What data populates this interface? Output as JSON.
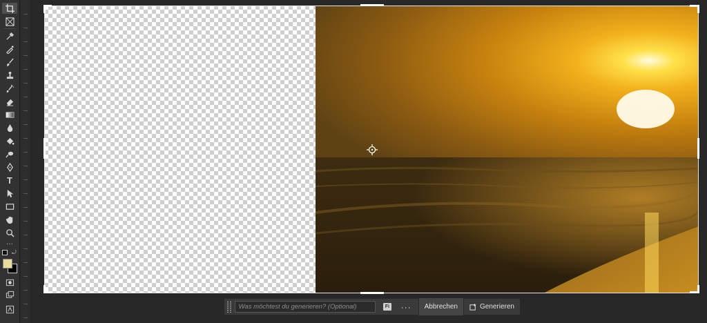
{
  "toolbar": {
    "tools": [
      {
        "icon": "crop-icon"
      },
      {
        "icon": "frame-icon"
      },
      {
        "icon": "eyedropper-icon"
      },
      {
        "icon": "spot-healing-icon"
      },
      {
        "icon": "brush-icon"
      },
      {
        "icon": "clone-stamp-icon"
      },
      {
        "icon": "history-brush-icon"
      },
      {
        "icon": "eraser-icon"
      },
      {
        "icon": "gradient-icon"
      },
      {
        "icon": "blur-icon"
      },
      {
        "icon": "paint-bucket-icon"
      },
      {
        "icon": "dodge-icon"
      },
      {
        "icon": "pen-icon"
      },
      {
        "icon": "type-icon",
        "glyph": "T"
      },
      {
        "icon": "path-selection-icon"
      },
      {
        "icon": "rectangle-icon"
      },
      {
        "icon": "hand-icon"
      },
      {
        "icon": "zoom-icon"
      },
      {
        "icon": "more-tools-icon",
        "glyph": "···"
      }
    ],
    "foreground_color": "#e8dc9a",
    "background_color": "#000000"
  },
  "taskbar": {
    "prompt_placeholder": "Was möchtest du generieren? (Optional)",
    "fi_label": "Fi",
    "more_label": "···",
    "cancel_label": "Abbrechen",
    "generate_label": "Generieren"
  }
}
